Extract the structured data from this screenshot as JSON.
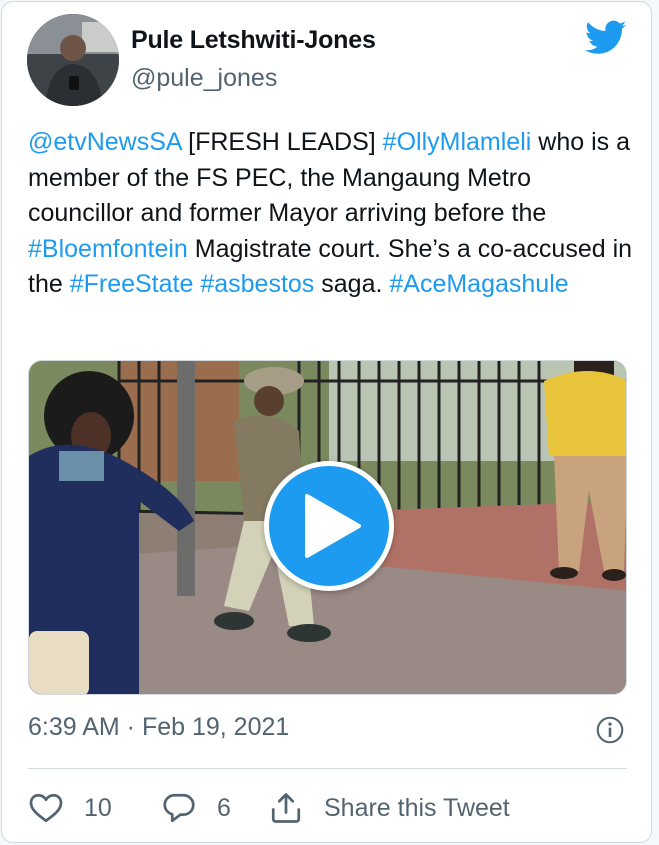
{
  "user": {
    "name": "Pule Letshwiti-Jones",
    "handle": "@pule_jones"
  },
  "tweet": {
    "parts": [
      {
        "text": "@etvNewsSA",
        "link": true
      },
      {
        "text": " [FRESH LEADS] ",
        "link": false
      },
      {
        "text": "#OllyMlamleli",
        "link": true
      },
      {
        "text": " who is a member of the FS PEC, the Mangaung Metro councillor and former Mayor arriving before the ",
        "link": false
      },
      {
        "text": "#Bloemfontein",
        "link": true
      },
      {
        "text": " Magistrate court. She’s a co-accused in the ",
        "link": false
      },
      {
        "text": "#FreeState",
        "link": true
      },
      {
        "text": " ",
        "link": false
      },
      {
        "text": "#asbestos",
        "link": true
      },
      {
        "text": " saga. ",
        "link": false
      },
      {
        "text": "#AceMagashule",
        "link": true
      }
    ],
    "timestamp": "6:39 AM · Feb 19, 2021"
  },
  "actions": {
    "likes": "10",
    "replies": "6",
    "share_label": "Share this Tweet"
  },
  "icons": {
    "brand": "twitter-bird-icon",
    "play": "play-icon",
    "info": "info-icon",
    "like": "heart-icon",
    "reply": "reply-bubble-icon",
    "share": "share-icon"
  },
  "colors": {
    "link": "#1d9bf0",
    "secondary_text": "#536471",
    "play_button": "#1d9bf0"
  }
}
